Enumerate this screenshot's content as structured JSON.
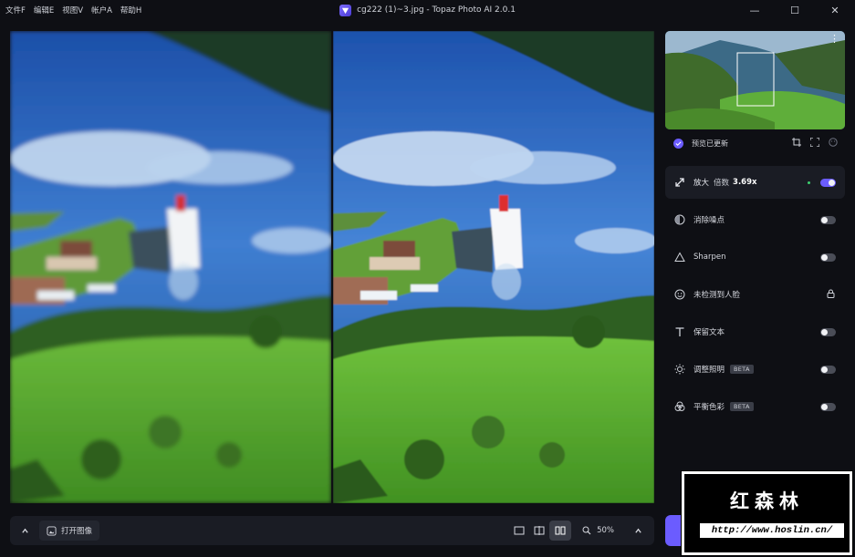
{
  "menu": [
    "文件F",
    "编辑E",
    "视图V",
    "帐户A",
    "帮助H"
  ],
  "window": {
    "title": "cg222 (1)~3.jpg - Topaz Photo AI 2.0.1",
    "minimize": "—",
    "maximize": "☐",
    "close": "✕"
  },
  "preview": {
    "status": "预览已更新"
  },
  "upscale": {
    "label": "放大",
    "factor_label": "倍数",
    "factor_value": "3.69x",
    "enabled": true
  },
  "tools": [
    {
      "label": "消除噪点",
      "icon": "denoise-icon",
      "enabled": false
    },
    {
      "label": "Sharpen",
      "icon": "sharpen-icon",
      "enabled": false
    },
    {
      "label": "未检测到人脸",
      "icon": "face-icon",
      "locked": true
    },
    {
      "label": "保留文本",
      "icon": "text-icon",
      "enabled": false
    },
    {
      "label": "调整照明",
      "icon": "light-icon",
      "badge": "BETA",
      "enabled": false
    },
    {
      "label": "平衡色彩",
      "icon": "color-balance-icon",
      "badge": "BETA",
      "enabled": false
    }
  ],
  "bottom": {
    "open_image": "打开图像",
    "zoom": "50%"
  },
  "watermark": {
    "title": "红森林",
    "url": "http://www.hoslin.cn/"
  },
  "colors": {
    "accent": "#6b5cff",
    "panel_bg": "#1a1c24",
    "app_bg": "#0e0f14"
  }
}
